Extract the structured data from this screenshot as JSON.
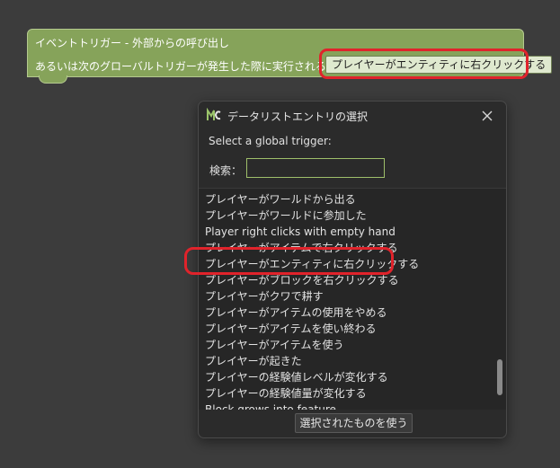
{
  "event_block": {
    "title": "イベントトリガー - 外部からの呼び出し",
    "description": "あるいは次のグローバルトリガーが発生した際に実行される:",
    "trigger_value": "プレイヤーがエンティティに右クリックする",
    "color": "#86a35a"
  },
  "dialog": {
    "title": "データリストエントリの選択",
    "app_icon": "mcreator-logo-icon",
    "close_icon": "close-icon",
    "prompt": "Select a global trigger:",
    "search": {
      "label": "検索：",
      "value": "",
      "placeholder": ""
    },
    "items": [
      "プレイヤーがワールドから出る",
      "プレイヤーがワールドに参加した",
      "Player right clicks with empty hand",
      "プレイヤーがアイテムで右クリックする",
      "プレイヤーがエンティティに右クリックする",
      "プレイヤーがブロックを右クリックする",
      "プレイヤーがクワで耕す",
      "プレイヤーがアイテムの使用をやめる",
      "プレイヤーがアイテムを使い終わる",
      "プレイヤーがアイテムを使う",
      "プレイヤーが起きた",
      "プレイヤーの経験値レベルが変化する",
      "プレイヤーの経験値量が変化する",
      "Block grows into feature"
    ],
    "use_button": "選択されたものを使う"
  },
  "highlight_color": "#e0232b"
}
